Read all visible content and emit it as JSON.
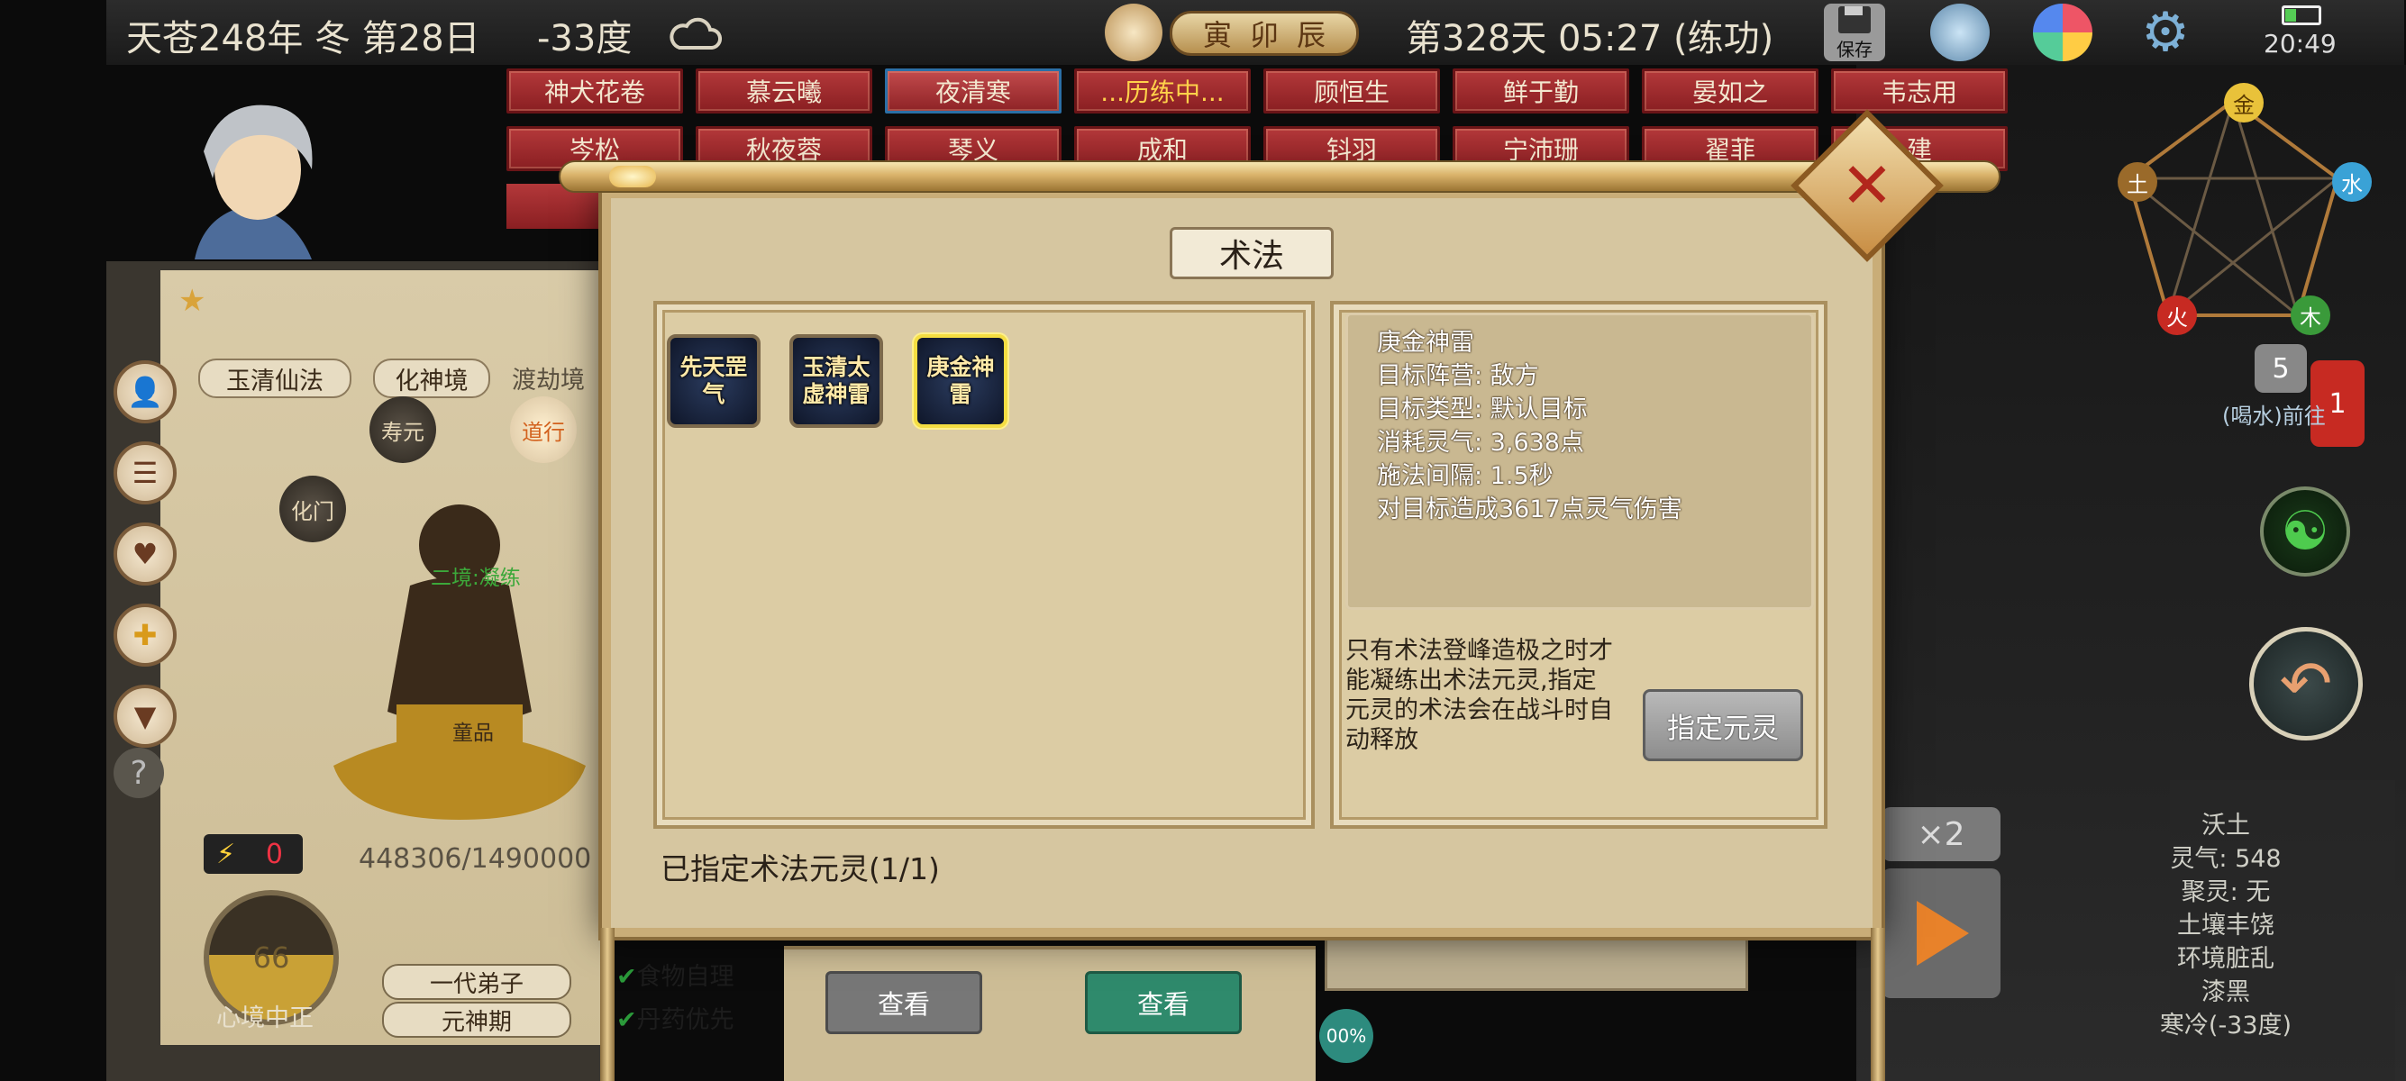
{
  "status": {
    "date": "天苍248年 冬 第28日",
    "temperature": "-33度",
    "weather_icon": "cloud-icon",
    "day_time": "第328天 05:27 (练功)",
    "earthly_branches": [
      "寅",
      "卯",
      "辰"
    ],
    "save_label": "保存",
    "clock": "20:49"
  },
  "name_tabs_row1": [
    "神犬花卷",
    "慕云曦",
    "夜清寒",
    "...历练中...",
    "顾恒生",
    "鲜于勤",
    "晏如之",
    "韦志用"
  ],
  "name_tabs_row2": [
    "岑松",
    "秋夜蓉",
    "琴义",
    "成和",
    "钭羽",
    "宁沛珊",
    "翟菲",
    "建"
  ],
  "left": {
    "sect": "玉清仙法",
    "realm": "化神境",
    "next_realm": "渡劫境",
    "nodes": [
      "寿元",
      "道行",
      "化门"
    ],
    "stage_label": "二境:凝练",
    "core_label": "童品",
    "lightning_count": "0",
    "cultivation": "448306/1490000",
    "mood_value": "66",
    "mood_label": "心境中正",
    "rank": "一代弟子",
    "period": "元神期",
    "food_option": "食物自理",
    "pill_option": "丹药优先",
    "view_label_1": "查看",
    "view_label_2": "查看",
    "progress_percent": "00%"
  },
  "right": {
    "elements": [
      "金",
      "水",
      "木",
      "火",
      "土"
    ],
    "unread_count": "5",
    "notify_count": "1",
    "task_text": "(喝水)前往",
    "speed": "×2",
    "terrain": "沃土",
    "info_lines": [
      "灵气: 548",
      "聚灵: 无",
      "土壤丰饶",
      "环境脏乱",
      "漆黑",
      "寒冷(-33度)"
    ]
  },
  "modal": {
    "title": "术法",
    "skills": [
      {
        "name": "先天罡气"
      },
      {
        "name": "玉清太虚神雷"
      },
      {
        "name": "庚金神雷",
        "selected": true
      }
    ],
    "detail": {
      "name": "庚金神雷",
      "faction": "目标阵营: 敌方",
      "target_type": "目标类型: 默认目标",
      "cost": "消耗灵气: 3,638点",
      "interval": "施法间隔: 1.5秒",
      "effect": "对目标造成3617点灵气伤害"
    },
    "note": "只有术法登峰造极之时才能凝练出术法元灵,指定元灵的术法会在战斗时自动释放",
    "assign_label": "指定元灵",
    "assigned_status": "已指定术法元灵(1/1)"
  },
  "colors": {
    "tab_red": "#a22a2d",
    "paper": "#d6c6a0",
    "accent_gold": "#c9ad78"
  }
}
